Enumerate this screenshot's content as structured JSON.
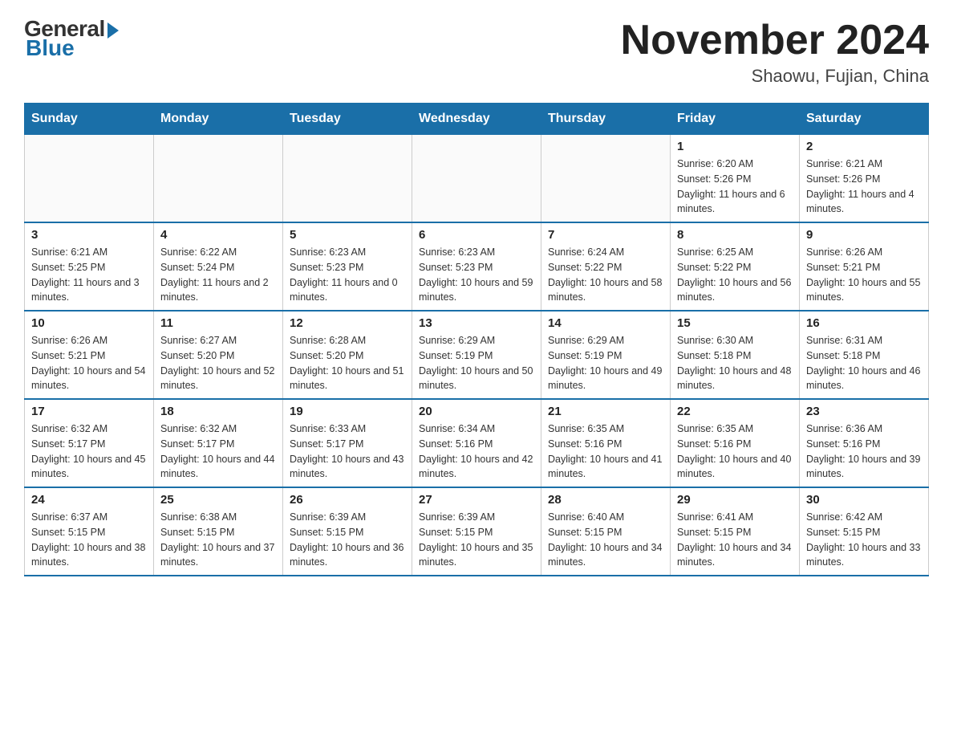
{
  "header": {
    "logo_general": "General",
    "logo_blue": "Blue",
    "month_title": "November 2024",
    "location": "Shaowu, Fujian, China"
  },
  "days_of_week": [
    "Sunday",
    "Monday",
    "Tuesday",
    "Wednesday",
    "Thursday",
    "Friday",
    "Saturday"
  ],
  "weeks": [
    [
      {
        "day": "",
        "info": ""
      },
      {
        "day": "",
        "info": ""
      },
      {
        "day": "",
        "info": ""
      },
      {
        "day": "",
        "info": ""
      },
      {
        "day": "",
        "info": ""
      },
      {
        "day": "1",
        "info": "Sunrise: 6:20 AM\nSunset: 5:26 PM\nDaylight: 11 hours and 6 minutes."
      },
      {
        "day": "2",
        "info": "Sunrise: 6:21 AM\nSunset: 5:26 PM\nDaylight: 11 hours and 4 minutes."
      }
    ],
    [
      {
        "day": "3",
        "info": "Sunrise: 6:21 AM\nSunset: 5:25 PM\nDaylight: 11 hours and 3 minutes."
      },
      {
        "day": "4",
        "info": "Sunrise: 6:22 AM\nSunset: 5:24 PM\nDaylight: 11 hours and 2 minutes."
      },
      {
        "day": "5",
        "info": "Sunrise: 6:23 AM\nSunset: 5:23 PM\nDaylight: 11 hours and 0 minutes."
      },
      {
        "day": "6",
        "info": "Sunrise: 6:23 AM\nSunset: 5:23 PM\nDaylight: 10 hours and 59 minutes."
      },
      {
        "day": "7",
        "info": "Sunrise: 6:24 AM\nSunset: 5:22 PM\nDaylight: 10 hours and 58 minutes."
      },
      {
        "day": "8",
        "info": "Sunrise: 6:25 AM\nSunset: 5:22 PM\nDaylight: 10 hours and 56 minutes."
      },
      {
        "day": "9",
        "info": "Sunrise: 6:26 AM\nSunset: 5:21 PM\nDaylight: 10 hours and 55 minutes."
      }
    ],
    [
      {
        "day": "10",
        "info": "Sunrise: 6:26 AM\nSunset: 5:21 PM\nDaylight: 10 hours and 54 minutes."
      },
      {
        "day": "11",
        "info": "Sunrise: 6:27 AM\nSunset: 5:20 PM\nDaylight: 10 hours and 52 minutes."
      },
      {
        "day": "12",
        "info": "Sunrise: 6:28 AM\nSunset: 5:20 PM\nDaylight: 10 hours and 51 minutes."
      },
      {
        "day": "13",
        "info": "Sunrise: 6:29 AM\nSunset: 5:19 PM\nDaylight: 10 hours and 50 minutes."
      },
      {
        "day": "14",
        "info": "Sunrise: 6:29 AM\nSunset: 5:19 PM\nDaylight: 10 hours and 49 minutes."
      },
      {
        "day": "15",
        "info": "Sunrise: 6:30 AM\nSunset: 5:18 PM\nDaylight: 10 hours and 48 minutes."
      },
      {
        "day": "16",
        "info": "Sunrise: 6:31 AM\nSunset: 5:18 PM\nDaylight: 10 hours and 46 minutes."
      }
    ],
    [
      {
        "day": "17",
        "info": "Sunrise: 6:32 AM\nSunset: 5:17 PM\nDaylight: 10 hours and 45 minutes."
      },
      {
        "day": "18",
        "info": "Sunrise: 6:32 AM\nSunset: 5:17 PM\nDaylight: 10 hours and 44 minutes."
      },
      {
        "day": "19",
        "info": "Sunrise: 6:33 AM\nSunset: 5:17 PM\nDaylight: 10 hours and 43 minutes."
      },
      {
        "day": "20",
        "info": "Sunrise: 6:34 AM\nSunset: 5:16 PM\nDaylight: 10 hours and 42 minutes."
      },
      {
        "day": "21",
        "info": "Sunrise: 6:35 AM\nSunset: 5:16 PM\nDaylight: 10 hours and 41 minutes."
      },
      {
        "day": "22",
        "info": "Sunrise: 6:35 AM\nSunset: 5:16 PM\nDaylight: 10 hours and 40 minutes."
      },
      {
        "day": "23",
        "info": "Sunrise: 6:36 AM\nSunset: 5:16 PM\nDaylight: 10 hours and 39 minutes."
      }
    ],
    [
      {
        "day": "24",
        "info": "Sunrise: 6:37 AM\nSunset: 5:15 PM\nDaylight: 10 hours and 38 minutes."
      },
      {
        "day": "25",
        "info": "Sunrise: 6:38 AM\nSunset: 5:15 PM\nDaylight: 10 hours and 37 minutes."
      },
      {
        "day": "26",
        "info": "Sunrise: 6:39 AM\nSunset: 5:15 PM\nDaylight: 10 hours and 36 minutes."
      },
      {
        "day": "27",
        "info": "Sunrise: 6:39 AM\nSunset: 5:15 PM\nDaylight: 10 hours and 35 minutes."
      },
      {
        "day": "28",
        "info": "Sunrise: 6:40 AM\nSunset: 5:15 PM\nDaylight: 10 hours and 34 minutes."
      },
      {
        "day": "29",
        "info": "Sunrise: 6:41 AM\nSunset: 5:15 PM\nDaylight: 10 hours and 34 minutes."
      },
      {
        "day": "30",
        "info": "Sunrise: 6:42 AM\nSunset: 5:15 PM\nDaylight: 10 hours and 33 minutes."
      }
    ]
  ]
}
